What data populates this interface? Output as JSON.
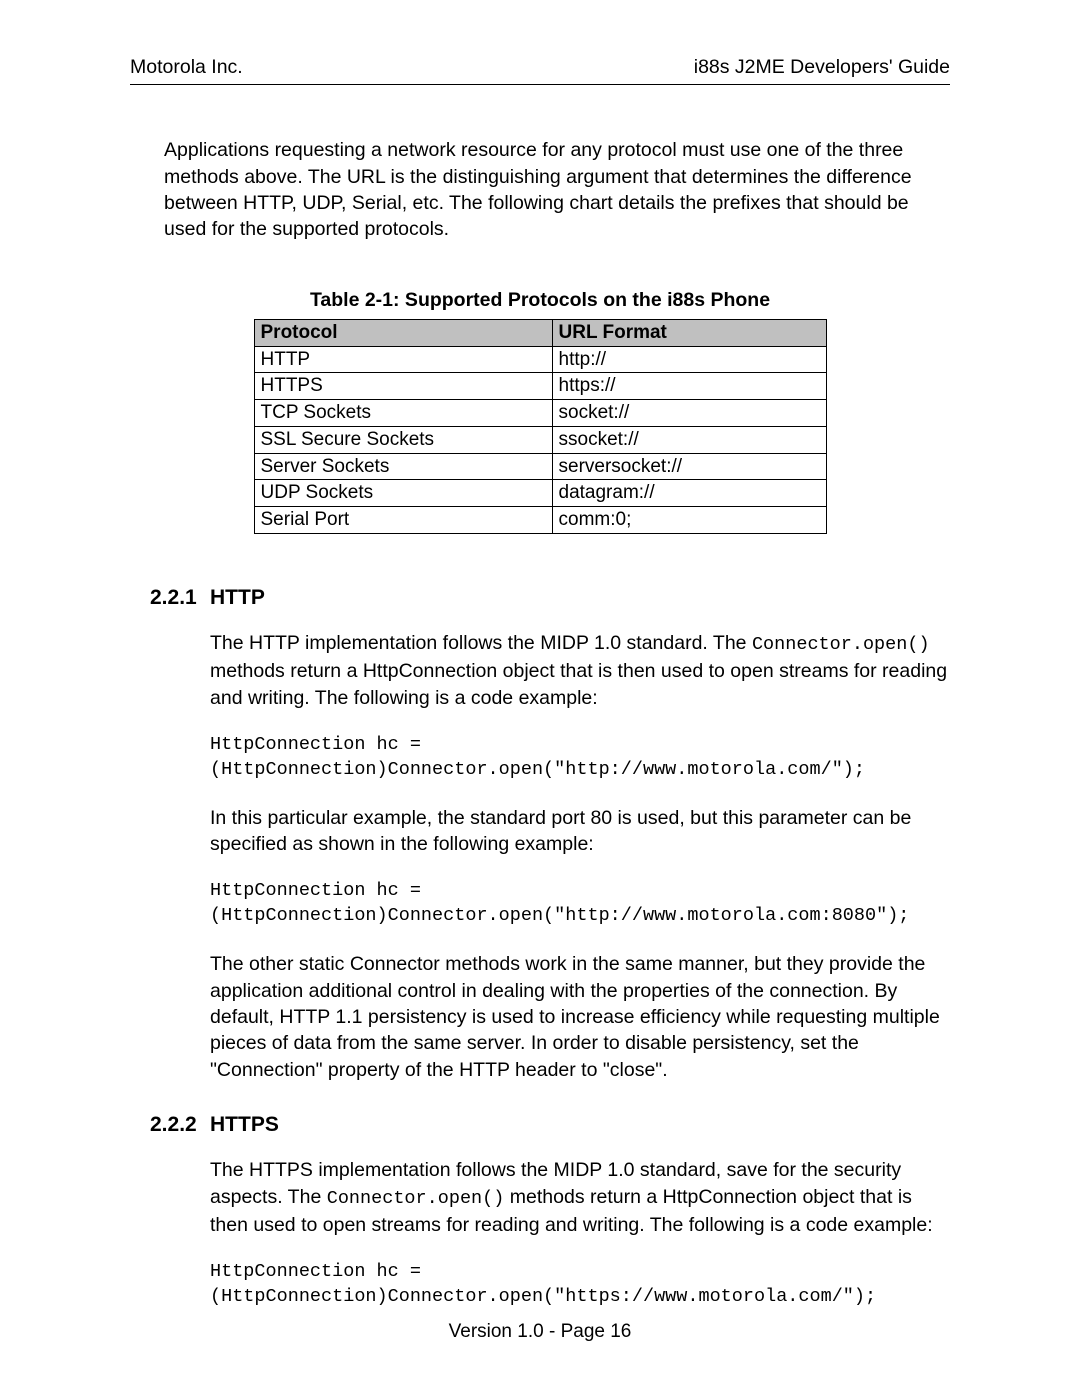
{
  "header": {
    "left": "Motorola Inc.",
    "right": "i88s J2ME Developers' Guide"
  },
  "intro": "Applications requesting a network resource for any protocol must use one of the three methods above.  The URL is the distinguishing argument that determines the difference between HTTP, UDP, Serial, etc.  The following chart details the prefixes that should be used for the supported protocols.",
  "table": {
    "caption": "Table 2-1: Supported Protocols on the i88s Phone",
    "headers": [
      "Protocol",
      "URL Format"
    ],
    "rows": [
      [
        "HTTP",
        "http://"
      ],
      [
        "HTTPS",
        "https://"
      ],
      [
        "TCP Sockets",
        "socket://"
      ],
      [
        "SSL Secure Sockets",
        "ssocket://"
      ],
      [
        "Server Sockets",
        "serversocket://"
      ],
      [
        "UDP Sockets",
        "datagram://"
      ],
      [
        "Serial Port",
        "comm:0;"
      ]
    ]
  },
  "sections": [
    {
      "number": "2.2.1",
      "title": "HTTP",
      "p1a": "The HTTP implementation follows the MIDP 1.0 standard. The ",
      "p1code": "Connector.open()",
      "p1b": " methods return a HttpConnection object that is then used to open streams for reading and writing.  The following is a code example:",
      "code1": "HttpConnection hc =\n(HttpConnection)Connector.open(\"http://www.motorola.com/\");",
      "p2": "In this particular example, the standard port 80 is used, but this parameter can be specified as shown in the following example:",
      "code2": "HttpConnection hc =\n(HttpConnection)Connector.open(\"http://www.motorola.com:8080\");",
      "p3": "The other static Connector methods work in the same manner, but they provide the application additional control in dealing with the properties of the connection.  By default, HTTP 1.1 persistency is used to increase efficiency while requesting multiple pieces of data from the same server.  In order to disable persistency, set the \"Connection\" property of the HTTP header to \"close\"."
    },
    {
      "number": "2.2.2",
      "title": "HTTPS",
      "p1a": "The HTTPS implementation follows the MIDP 1.0 standard, save for the security aspects.  The ",
      "p1code": "Connector.open()",
      "p1b": " methods return a HttpConnection object that is then used to open streams for reading and writing.  The following is a code example:",
      "code1": "HttpConnection hc =\n(HttpConnection)Connector.open(\"https://www.motorola.com/\");"
    }
  ],
  "footer": "Version 1.0 - Page 16"
}
